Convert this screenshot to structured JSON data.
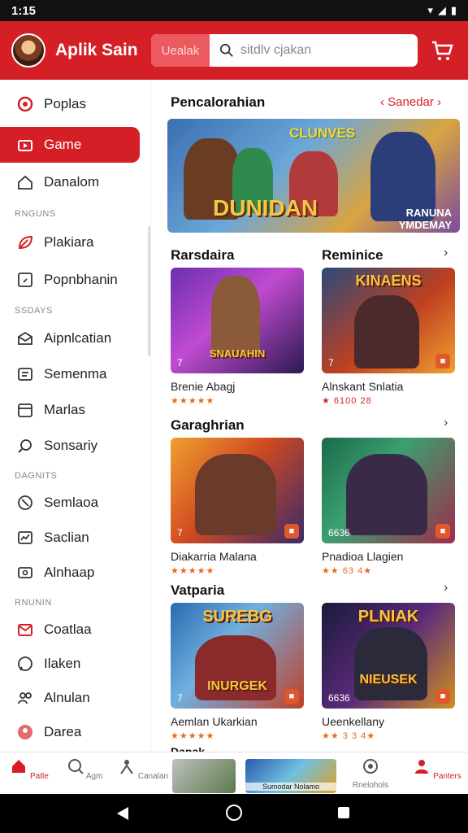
{
  "status_bar": {
    "time": "1:15"
  },
  "header": {
    "title": "Aplik Sain",
    "search_tag": "Uealak",
    "search_placeholder": "sitdlv cjakan"
  },
  "sidebar": {
    "items": [
      {
        "label": "Poplas"
      },
      {
        "label": "Game"
      },
      {
        "label": "Danalom"
      },
      {
        "label": "Plakiara"
      },
      {
        "label": "Popnbhanin"
      },
      {
        "label": "Aipnlcatian"
      },
      {
        "label": "Semenma"
      },
      {
        "label": "Marlas"
      },
      {
        "label": "Sonsariy"
      },
      {
        "label": "Semlaoa"
      },
      {
        "label": "Saclian"
      },
      {
        "label": "Alnhaap"
      },
      {
        "label": "Coatlaa"
      },
      {
        "label": "Ilaken"
      },
      {
        "label": "Alnulan"
      },
      {
        "label": "Darea"
      }
    ],
    "headings": [
      "RNGUNS",
      "SSDAYS",
      "DAGNITS",
      "RNUNIN"
    ]
  },
  "main": {
    "featured": {
      "title": "Pencalorahian",
      "link": "Sanedar",
      "banner_title": "DUNIDAN",
      "banner_subtitle": "CLUNVES",
      "banner_tag": "RANUNA\nYMDEMAY"
    },
    "sections": [
      {
        "title": "Rarsdaira",
        "title2": "Reminice"
      },
      {
        "title": "Garaghrian"
      },
      {
        "title": "Vatparia"
      }
    ],
    "cards": [
      {
        "name": "Brenie Abagj",
        "rating": "★★★★★",
        "num": "7",
        "art": "SNAUAHIN"
      },
      {
        "name": "Alnskant Snlatia",
        "rating": "★ 6100 28",
        "num": "7",
        "art": "KINAENS"
      },
      {
        "name": "Diakarria Malana",
        "rating": "★★★★★",
        "num": "7",
        "art": ""
      },
      {
        "name": "Pnadioa Llagien",
        "rating": "★★ 63 4★",
        "num": "6636",
        "art": ""
      },
      {
        "name": "Aemlan Ukarkian",
        "rating": "★★★★★",
        "num": "7",
        "art": "SUREBG"
      },
      {
        "name": "Ueenkellany",
        "rating": "★★ 3 3 4★",
        "num": "6636",
        "art": "PLNIAK"
      }
    ],
    "card_art_bottom": [
      "",
      "",
      "",
      "",
      "INURGEK",
      "NIEUSEK"
    ],
    "cut_title": "Dapak"
  },
  "bottom_nav": {
    "items": [
      {
        "label": "Patle"
      },
      {
        "label": "Agm"
      },
      {
        "label": "Canalan"
      },
      {
        "label": "Rnelohols"
      },
      {
        "label": "Panters"
      }
    ],
    "thumb_caption": "Sumodar Nolamo"
  },
  "colors": {
    "accent": "#d51f26",
    "rating": "#e76a1a"
  }
}
